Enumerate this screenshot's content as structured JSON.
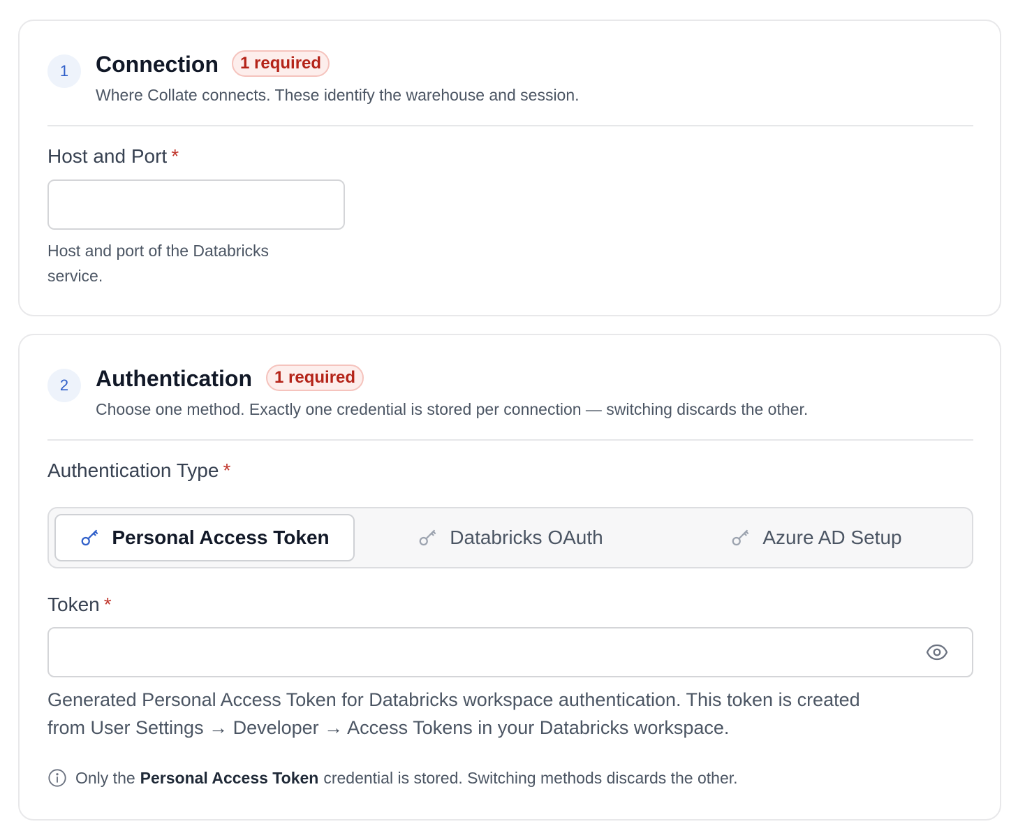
{
  "connection": {
    "step": "1",
    "title": "Connection",
    "badge": "1 required",
    "description": "Where Collate connects. These identify the warehouse and session.",
    "host_port": {
      "label": "Host and Port",
      "required_mark": "*",
      "value": "",
      "help_line1": "Host and port of the Databricks",
      "help_line2": "service."
    }
  },
  "authentication": {
    "step": "2",
    "title": "Authentication",
    "badge": "1 required",
    "description": "Choose one method. Exactly one credential is stored per connection — switching discards the other.",
    "auth_type": {
      "label": "Authentication Type",
      "required_mark": "*",
      "options": [
        {
          "label": "Personal Access Token",
          "icon": "key-icon",
          "selected": true
        },
        {
          "label": "Databricks OAuth",
          "icon": "key-icon",
          "selected": false
        },
        {
          "label": "Azure AD Setup",
          "icon": "key-icon",
          "selected": false
        }
      ]
    },
    "token": {
      "label": "Token",
      "required_mark": "*",
      "value": "",
      "help_line1": "Generated Personal Access Token for Databricks workspace authentication. This token is created",
      "help_line2": "from User Settings → Developer → Access Tokens in your Databricks workspace."
    },
    "note": {
      "prefix": "Only the",
      "emphasis": "Personal Access Token",
      "suffix": "credential is stored. Switching methods discards the other."
    }
  },
  "colors": {
    "accent_blue": "#2f5fc9",
    "required_red": "#b42318",
    "badge_bg": "#fdeeec"
  }
}
